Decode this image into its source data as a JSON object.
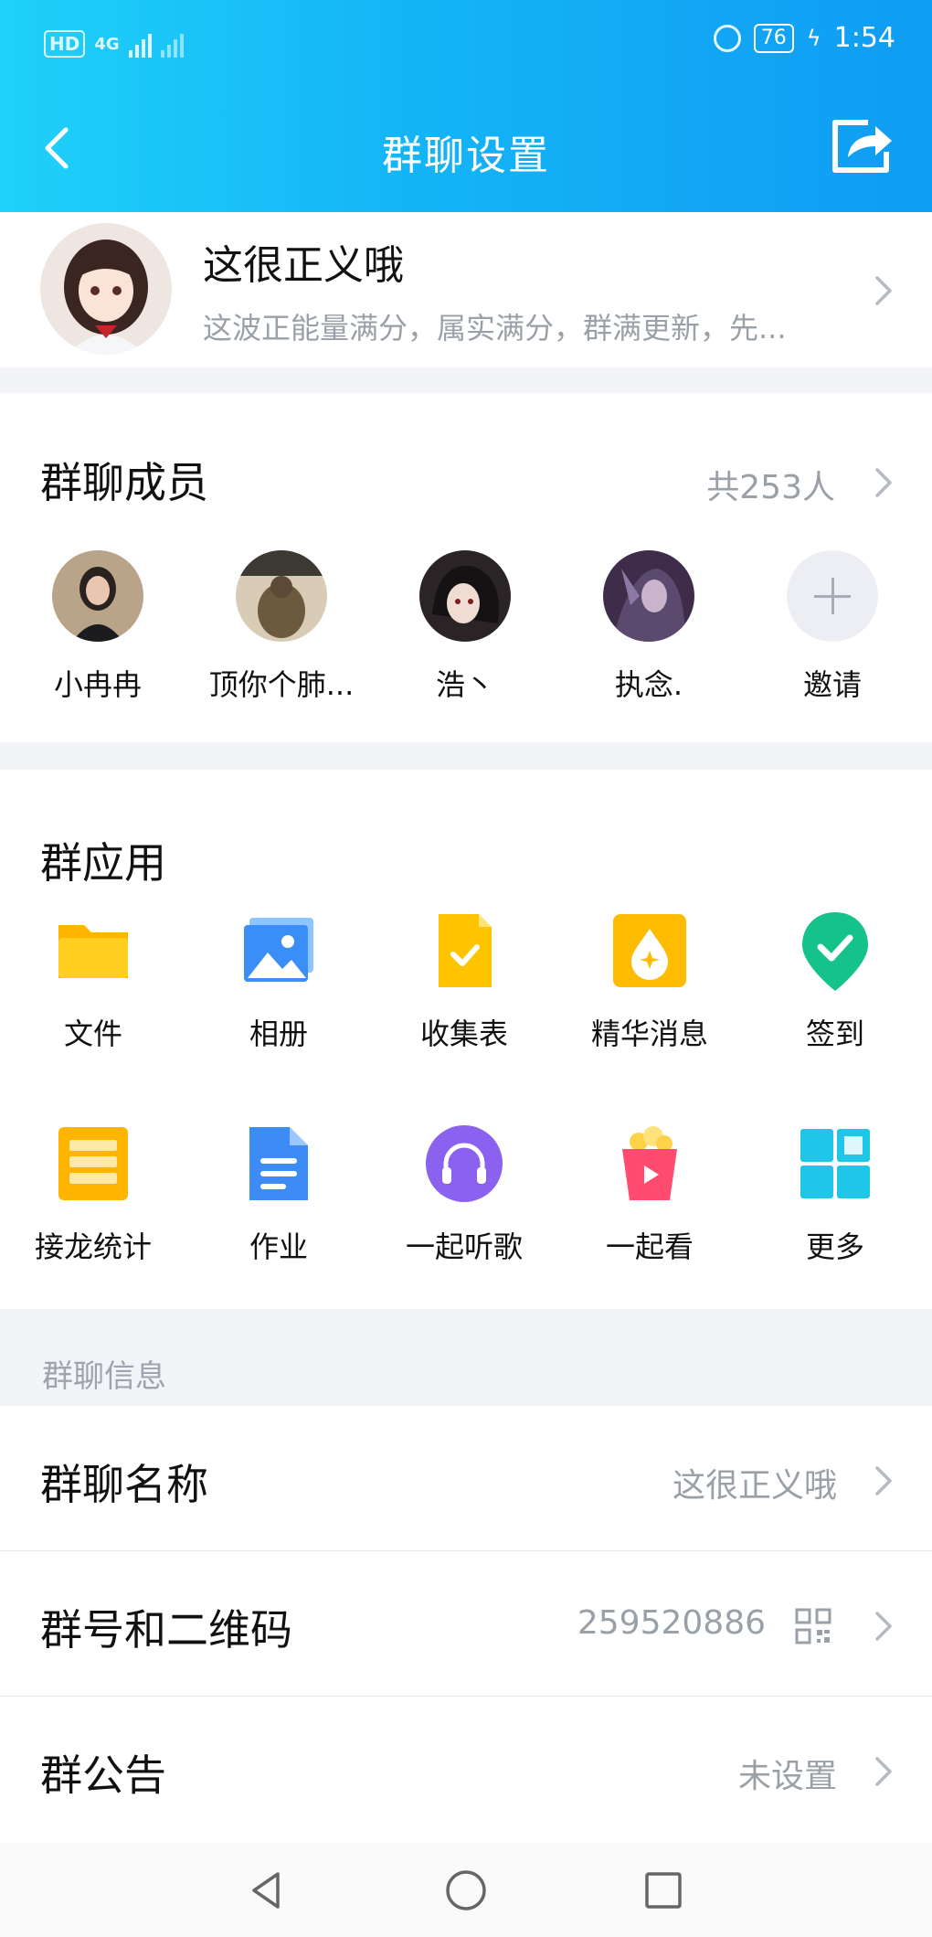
{
  "status": {
    "network": "4G",
    "battery": "76",
    "time": "1:54"
  },
  "header": {
    "title": "群聊设置"
  },
  "group": {
    "name": "这很正义哦",
    "description": "这波正能量满分，属实满分，群满更新，先..."
  },
  "members": {
    "title": "群聊成员",
    "count": "共253人",
    "list": [
      {
        "name": "小冉冉"
      },
      {
        "name": "顶你个肺..."
      },
      {
        "name": "浩丶"
      },
      {
        "name": "执念."
      }
    ],
    "invite_label": "邀请"
  },
  "apps": {
    "title": "群应用",
    "items": [
      {
        "label": "文件",
        "icon": "folder-icon"
      },
      {
        "label": "相册",
        "icon": "album-icon"
      },
      {
        "label": "收集表",
        "icon": "form-icon"
      },
      {
        "label": "精华消息",
        "icon": "essence-icon"
      },
      {
        "label": "签到",
        "icon": "checkin-icon"
      },
      {
        "label": "接龙统计",
        "icon": "relay-icon"
      },
      {
        "label": "作业",
        "icon": "homework-icon"
      },
      {
        "label": "一起听歌",
        "icon": "headphones-icon"
      },
      {
        "label": "一起看",
        "icon": "popcorn-icon"
      },
      {
        "label": "更多",
        "icon": "grid-icon"
      }
    ]
  },
  "info": {
    "header": "群聊信息",
    "rows": [
      {
        "label": "群聊名称",
        "value": "这很正义哦"
      },
      {
        "label": "群号和二维码",
        "value": "259520886"
      },
      {
        "label": "群公告",
        "value": "未设置"
      }
    ]
  },
  "colors": {
    "accent": "#12a9f5",
    "muted": "#9aa0a8"
  }
}
